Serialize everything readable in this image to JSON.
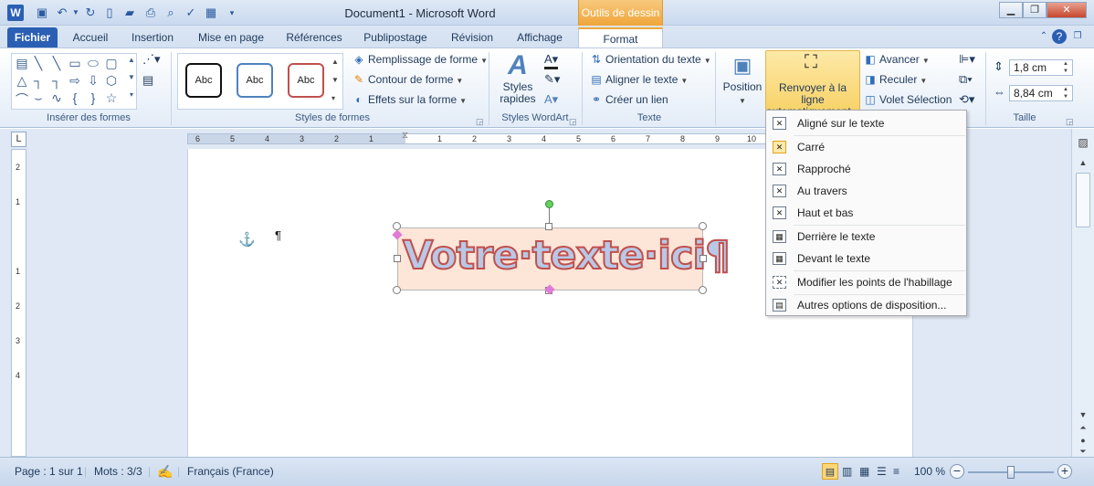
{
  "window": {
    "doc_title": "Document1  -  Microsoft Word",
    "context_tab": "Outils de dessin"
  },
  "tabs": [
    "Fichier",
    "Accueil",
    "Insertion",
    "Mise en page",
    "Références",
    "Publipostage",
    "Révision",
    "Affichage",
    "Format"
  ],
  "ribbon": {
    "groups": {
      "inserer": "Insérer des formes",
      "styles_formes": "Styles de formes",
      "wordart": "Styles WordArt",
      "texte": "Texte",
      "taille": "Taille"
    },
    "shape_styles": {
      "abc1": "Abc",
      "abc2": "Abc",
      "abc3": "Abc"
    },
    "remplissage": "Remplissage de forme",
    "contour": "Contour de forme",
    "effets": "Effets sur la forme",
    "styles_rapides": "Styles rapides",
    "orientation": "Orientation du texte",
    "aligner_texte": "Aligner le texte",
    "creer_lien": "Créer un lien",
    "position": "Position",
    "renvoyer": "Renvoyer à la ligne automatiquement",
    "avancer": "Avancer",
    "reculer": "Reculer",
    "volet": "Volet Sélection",
    "hauteur": "1,8 cm",
    "largeur": "8,84 cm"
  },
  "ruler": {
    "ticks_left": [
      "6",
      "5",
      "4",
      "3",
      "2",
      "1"
    ],
    "ticks_right": [
      "1",
      "2",
      "3",
      "4",
      "5",
      "6",
      "7",
      "8",
      "9",
      "10"
    ],
    "vticks": [
      "2",
      "1",
      "1",
      "2",
      "3",
      "4"
    ]
  },
  "document": {
    "wordart_text": "Votre·texte·ici¶",
    "anchor": "⚓",
    "pilcrow": "¶"
  },
  "wrap_menu": {
    "items": [
      "Aligné sur le texte",
      "Carré",
      "Rapproché",
      "Au travers",
      "Haut et bas",
      "Derrière le texte",
      "Devant le texte",
      "Modifier les points de l'habillage",
      "Autres options de disposition..."
    ],
    "selected_index": 1
  },
  "status": {
    "page": "Page : 1 sur 1",
    "mots": "Mots : 3/3",
    "langue": "Français (France)",
    "zoom": "100 %",
    "zoom_level": 100
  },
  "colors": {
    "accent": "#2b5fb4",
    "context": "#f0a53a",
    "wordart_outline": "#c0504d",
    "wordart_fill": "#b8c8e6",
    "textbox_fill": "#fde5d8"
  }
}
